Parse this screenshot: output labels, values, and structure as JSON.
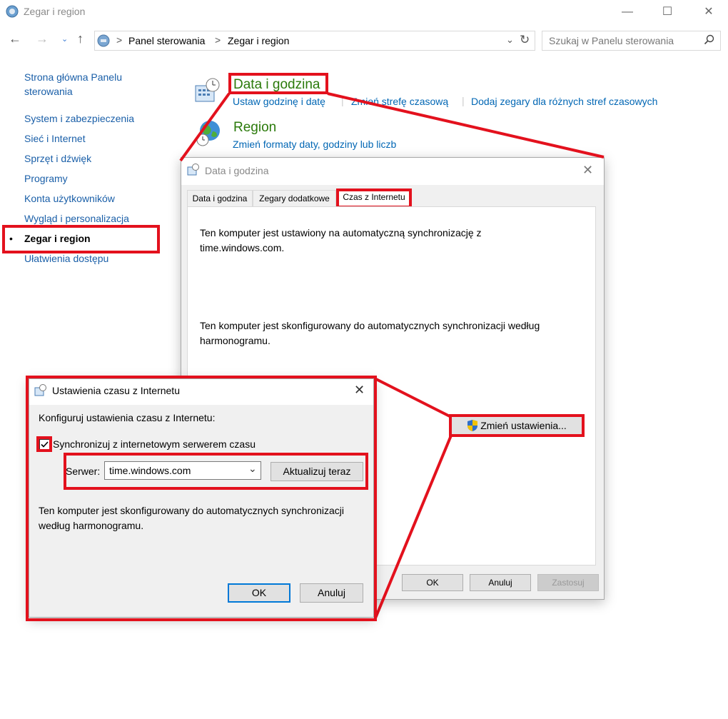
{
  "window": {
    "title": "Zegar i region",
    "minimize": "—",
    "maximize": "☐",
    "close": "✕"
  },
  "address": {
    "crumbs": [
      "Panel sterowania",
      "Zegar i region"
    ],
    "separator": ">",
    "search_placeholder": "Szukaj w Panelu sterowania"
  },
  "leftnav": {
    "home": "Strona główna Panelu sterowania",
    "items": [
      "System i zabezpieczenia",
      "Sieć i Internet",
      "Sprzęt i dźwięk",
      "Programy",
      "Konta użytkowników",
      "Wygląd i personalizacja",
      "Zegar i region",
      "Ułatwienia dostępu"
    ],
    "active_index": 6
  },
  "main": {
    "datetime": {
      "title": "Data i godzina",
      "links": [
        "Ustaw godzinę i datę",
        "Zmień strefę czasową",
        "Dodaj zegary dla różnych stref czasowych"
      ]
    },
    "region": {
      "title": "Region",
      "link": "Zmień formaty daty, godziny lub liczb"
    }
  },
  "dt_dialog": {
    "title": "Data i godzina",
    "tabs": [
      "Data i godzina",
      "Zegary dodatkowe",
      "Czas z Internetu"
    ],
    "active_tab": 2,
    "text1": "Ten komputer jest ustawiony na automatyczną synchronizację z time.windows.com.",
    "text2": "Ten komputer jest skonfigurowany do automatycznych synchronizacji według harmonogramu.",
    "change_button": "Zmień ustawienia...",
    "ok": "OK",
    "cancel": "Anuluj",
    "apply": "Zastosuj"
  },
  "inet_dialog": {
    "title": "Ustawienia czasu z Internetu",
    "heading": "Konfiguruj ustawienia czasu z Internetu:",
    "sync_label": "Synchronizuj z internetowym serwerem czasu",
    "sync_checked": true,
    "server_label": "Serwer:",
    "server_value": "time.windows.com",
    "update_button": "Aktualizuj teraz",
    "info": "Ten komputer jest skonfigurowany do automatycznych synchronizacji według harmonogramu.",
    "ok": "OK",
    "cancel": "Anuluj"
  },
  "colors": {
    "annotation_red": "#e3111d",
    "link_blue": "#0066b4",
    "title_green": "#2b7a0b"
  }
}
